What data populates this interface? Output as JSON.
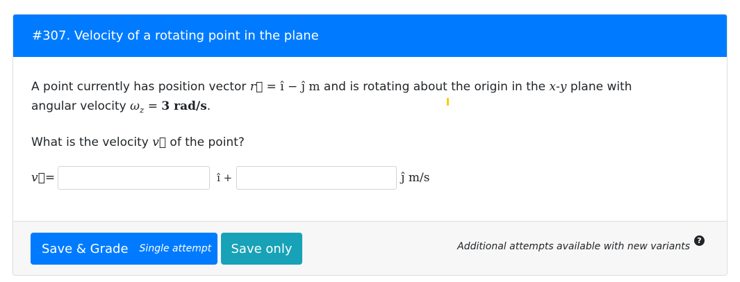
{
  "question": {
    "title": "#307. Velocity of a rotating point in the plane",
    "p1_a": "A point currently has position vector ",
    "p1_rvec": "r⃗",
    "p1_eq1": " = ",
    "p1_ihat": "ı̂",
    "p1_minus": " − ",
    "p1_jhat": "ȷ̂",
    "p1_unit": " m",
    "p1_b": " and is rotating about the origin in the ",
    "p1_x": "x",
    "p1_dash": "-",
    "p1_y": "y",
    "p1_c": " plane with",
    "p2_a": "angular velocity ",
    "p2_omega": "ω",
    "p2_sub": "z",
    "p2_eq": " = ",
    "p2_val": "3 rad/s",
    "p2_b": ".",
    "q_a": "What is the velocity ",
    "q_vvec": "v⃗",
    "q_b": " of the point?"
  },
  "answer": {
    "vvec": "v⃗",
    "eq": " = ",
    "i_label": "ı̂ + ",
    "j_label": "ȷ̂ m/s",
    "input_i_value": "",
    "input_j_value": ""
  },
  "footer": {
    "grade_label": "Save & Grade",
    "grade_sub": "Single attempt",
    "save_label": "Save only",
    "attempts_text": "Additional attempts available with new variants",
    "help_glyph": "?"
  },
  "colors": {
    "primary": "#007bff",
    "info": "#17a2b8",
    "footer_bg": "#f7f7f7"
  }
}
